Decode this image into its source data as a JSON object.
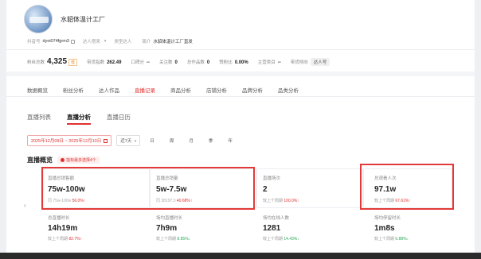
{
  "shop": {
    "name": "水貂体温计工厂"
  },
  "info": {
    "douyin_label": "抖音号",
    "douyin_value": "dyoi074fgrm3",
    "talent_label": "达人搭来",
    "similar_label": "类型达人",
    "intro_label": "简介",
    "intro_value": "水貂体温计工厂直发"
  },
  "stats": [
    {
      "label": "粉丝总数",
      "value": "4,325",
      "tag": "低"
    },
    {
      "label": "带货指数",
      "value": "262.49"
    },
    {
      "label": "口碑分",
      "value": "--"
    },
    {
      "label": "关注数",
      "value": "0"
    },
    {
      "label": "总作品数",
      "value": "0"
    },
    {
      "label": "赞粉比",
      "value": "0.00%"
    },
    {
      "label": "主营类目",
      "value": "--"
    },
    {
      "label": "带货倾向",
      "value": "达人号"
    }
  ],
  "main_tabs": [
    "数据概览",
    "粉丝分析",
    "达人作品",
    "直播记录",
    "商品分析",
    "店铺分析",
    "品牌分析",
    "品类分析"
  ],
  "main_tabs_active": "直播记录",
  "sub_tabs": [
    "直播列表",
    "直播分析",
    "直播日历"
  ],
  "sub_tabs_active": "直播分析",
  "filter": {
    "date_range": "2025年12月09日 ~ 2025年12月10日",
    "range_select": "近7天",
    "periods": [
      "日",
      "周",
      "月",
      "季",
      "年"
    ]
  },
  "overview": {
    "title": "直播概览",
    "hint": "指标最多选择4个"
  },
  "metrics_row1": [
    {
      "label": "直播总销售额",
      "value": "75w-100w",
      "cmp_prefix": "同",
      "cmp_text": "75w-100w",
      "cmp_pct": "56.0%",
      "dir": "up"
    },
    {
      "label": "直播总销量",
      "value": "5w-7.5w",
      "cmp_prefix": "同",
      "cmp_text": "38197.5",
      "cmp_pct": "40.68%",
      "dir": "up"
    },
    {
      "label": "直播场次",
      "value": "2",
      "cmp_prefix": "较上个周期",
      "cmp_pct": "100.0%",
      "dir": "up"
    },
    {
      "label": "总观看人次",
      "value": "97.1w",
      "cmp_prefix": "较上个周期",
      "cmp_pct": "67.61%",
      "dir": "up"
    }
  ],
  "metrics_row2": [
    {
      "label": "总直播时长",
      "value": "14h19m",
      "cmp_prefix": "较上个周期",
      "cmp_pct": "82.7%",
      "dir": "up"
    },
    {
      "label": "场均直播时长",
      "value": "7h9m",
      "cmp_prefix": "较上个周期",
      "cmp_pct": "8.85%",
      "dir": "down"
    },
    {
      "label": "场均在线人数",
      "value": "1281",
      "cmp_prefix": "较上个周期",
      "cmp_pct": "14.43%",
      "dir": "down"
    },
    {
      "label": "场均停留时长",
      "value": "1m8s",
      "cmp_prefix": "较上个周期",
      "cmp_pct": "6.88%",
      "dir": "down"
    }
  ],
  "colors": {
    "accent": "#e0312f",
    "highlight_box": "#e23a39",
    "down": "#2aa85a"
  }
}
